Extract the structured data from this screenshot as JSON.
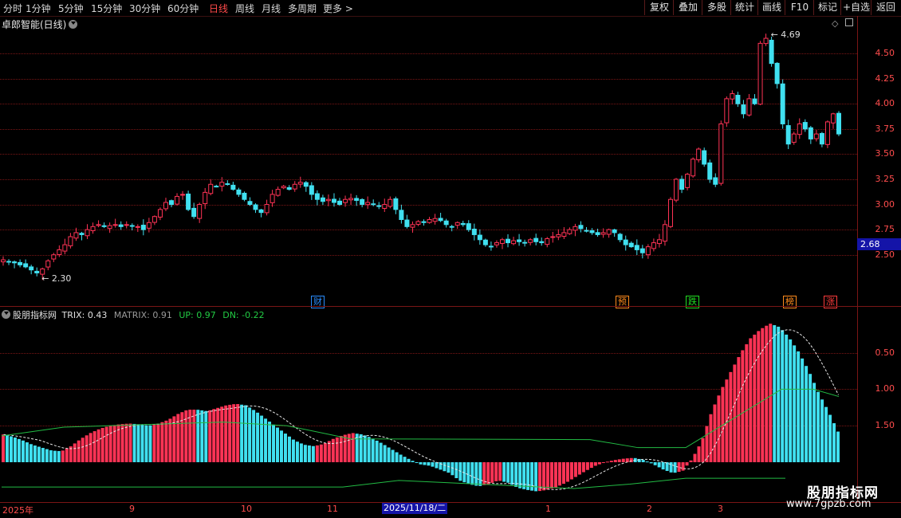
{
  "toolbar": {
    "timeframes": [
      "分时",
      "1分钟",
      "5分钟",
      "15分钟",
      "30分钟",
      "60分钟",
      "日线",
      "周线",
      "月线",
      "多周期",
      "更多 >"
    ],
    "active_timeframe": "日线",
    "right_buttons": [
      "复权",
      "叠加",
      "多股",
      "统计",
      "画线",
      "F10",
      "标记",
      "+自选",
      "返回"
    ]
  },
  "main_panel": {
    "stock_title": "卓郎智能(日线)",
    "price_ticks": [
      "4.50",
      "4.25",
      "4.00",
      "3.75",
      "3.50",
      "3.25",
      "3.00",
      "2.75",
      "2.50"
    ],
    "current_price": "2.68",
    "high_label": "4.69",
    "low_label": "2.30",
    "event_tags": [
      {
        "label": "财",
        "color": "#2a8cff"
      },
      {
        "label": "预",
        "color": "#ff8a1c"
      },
      {
        "label": "跌",
        "color": "#22dd22"
      },
      {
        "label": "榜",
        "color": "#ff8a1c"
      },
      {
        "label": "涨",
        "color": "#ff3c3c"
      }
    ]
  },
  "indicator_panel": {
    "name": "股朋指标网",
    "trix_label": "TRIX: 0.43",
    "matrix_label": "MATRIX: 0.91",
    "up_label": "UP: 0.97",
    "dn_label": "DN: -0.22",
    "y_ticks": [
      "1.50",
      "1.00",
      "0.50"
    ]
  },
  "x_axis": {
    "labels": [
      "2025年",
      "9",
      "10",
      "11",
      "1",
      "2",
      "3"
    ],
    "cursor_date": "2025/11/18/二"
  },
  "watermark": {
    "title": "股朋指标网",
    "url": "www.7gpzb.com"
  },
  "colors": {
    "up": "#ff3355",
    "down": "#40e0f0",
    "axis": "#ff4d4d",
    "grid": "#7a1515"
  },
  "chart_data": [
    {
      "type": "candlestick",
      "title": "卓郎智能(日线)",
      "ylim": [
        2.3,
        4.69
      ],
      "y_ticks": [
        2.5,
        2.75,
        3.0,
        3.25,
        3.5,
        3.75,
        4.0,
        4.25,
        4.5
      ],
      "close_path": [
        2.45,
        2.43,
        2.42,
        2.4,
        2.38,
        2.35,
        2.32,
        2.36,
        2.44,
        2.5,
        2.55,
        2.6,
        2.68,
        2.72,
        2.7,
        2.75,
        2.78,
        2.8,
        2.78,
        2.79,
        2.8,
        2.78,
        2.8,
        2.79,
        2.78,
        2.75,
        2.82,
        2.88,
        2.95,
        3.02,
        3.0,
        3.08,
        3.1,
        2.95,
        2.88,
        3.0,
        3.12,
        3.2,
        3.18,
        3.22,
        3.2,
        3.15,
        3.1,
        3.05,
        3.0,
        2.95,
        2.92,
        3.0,
        3.1,
        3.15,
        3.18,
        3.15,
        3.2,
        3.22,
        3.18,
        3.1,
        3.05,
        3.03,
        3.05,
        3.02,
        3.0,
        3.05,
        3.06,
        3.04,
        3.0,
        3.02,
        3.0,
        2.98,
        3.0,
        3.05,
        2.95,
        2.85,
        2.78,
        2.8,
        2.83,
        2.82,
        2.85,
        2.86,
        2.84,
        2.8,
        2.78,
        2.82,
        2.8,
        2.75,
        2.7,
        2.65,
        2.6,
        2.58,
        2.62,
        2.65,
        2.62,
        2.64,
        2.63,
        2.62,
        2.65,
        2.63,
        2.62,
        2.66,
        2.68,
        2.7,
        2.72,
        2.75,
        2.78,
        2.76,
        2.74,
        2.72,
        2.7,
        2.72,
        2.75,
        2.72,
        2.65,
        2.6,
        2.58,
        2.55,
        2.52,
        2.58,
        2.62,
        2.65,
        2.8,
        3.05,
        3.25,
        3.15,
        3.3,
        3.45,
        3.55,
        3.4,
        3.25,
        3.2,
        3.8,
        4.05,
        4.1,
        4.0,
        3.9,
        4.05,
        4.0,
        4.6,
        4.65,
        4.4,
        4.2,
        3.8,
        3.6,
        3.7,
        3.8,
        3.75,
        3.65,
        3.7,
        3.6,
        3.82,
        3.9,
        3.7
      ],
      "current_price": 2.68,
      "annotations": [
        {
          "text": "4.69",
          "value": 4.69
        },
        {
          "text": "2.30",
          "value": 2.3
        }
      ]
    },
    {
      "type": "bar",
      "title": "TRIX",
      "ylim": [
        -0.4,
        1.95
      ],
      "y_ticks": [
        0.5,
        1.0,
        1.5
      ],
      "trix_path": [
        0.38,
        0.35,
        0.3,
        0.24,
        0.2,
        0.16,
        0.15,
        0.22,
        0.32,
        0.4,
        0.46,
        0.5,
        0.52,
        0.53,
        0.52,
        0.5,
        0.53,
        0.58,
        0.66,
        0.72,
        0.72,
        0.7,
        0.74,
        0.78,
        0.8,
        0.78,
        0.7,
        0.6,
        0.5,
        0.4,
        0.3,
        0.24,
        0.22,
        0.25,
        0.32,
        0.37,
        0.4,
        0.38,
        0.33,
        0.26,
        0.18,
        0.1,
        0.03,
        -0.03,
        -0.05,
        -0.1,
        -0.15,
        -0.25,
        -0.3,
        -0.33,
        -0.3,
        -0.25,
        -0.28,
        -0.35,
        -0.38,
        -0.4,
        -0.38,
        -0.34,
        -0.28,
        -0.2,
        -0.12,
        -0.05,
        0.0,
        0.03,
        0.05,
        0.06,
        0.03,
        -0.03,
        -0.1,
        -0.15,
        -0.12,
        0.05,
        0.3,
        0.7,
        1.0,
        1.25,
        1.5,
        1.7,
        1.82,
        1.9,
        1.85,
        1.7,
        1.5,
        1.25,
        0.95,
        0.7,
        0.42
      ],
      "trix": 0.43,
      "matrix": 0.91,
      "up": 0.97,
      "dn": -0.22
    }
  ]
}
